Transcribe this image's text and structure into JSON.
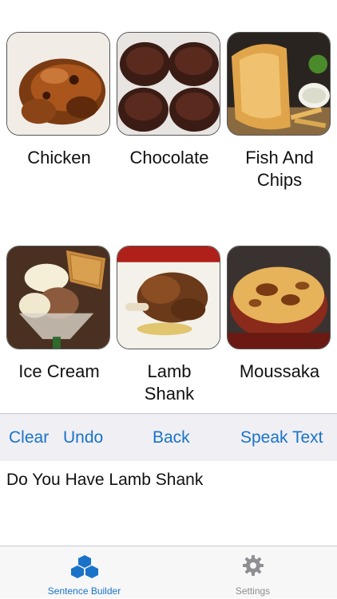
{
  "tiles": [
    {
      "label": "Chicken"
    },
    {
      "label": "Chocolate"
    },
    {
      "label": "Fish And\nChips"
    },
    {
      "label": "Ice Cream"
    },
    {
      "label": "Lamb\nShank"
    },
    {
      "label": "Moussaka"
    }
  ],
  "toolbar": {
    "clear": "Clear",
    "undo": "Undo",
    "back": "Back",
    "speak": "Speak Text"
  },
  "sentence": "Do You Have Lamb Shank",
  "tabs": [
    {
      "label": "Sentence Builder",
      "icon": "cubes-icon",
      "color": "#1a73c9"
    },
    {
      "label": "Settings",
      "icon": "gear-icon",
      "color": "#8e8e93"
    }
  ],
  "colors": {
    "accent": "#1a73c9",
    "toolbar_bg": "#efeff4"
  }
}
